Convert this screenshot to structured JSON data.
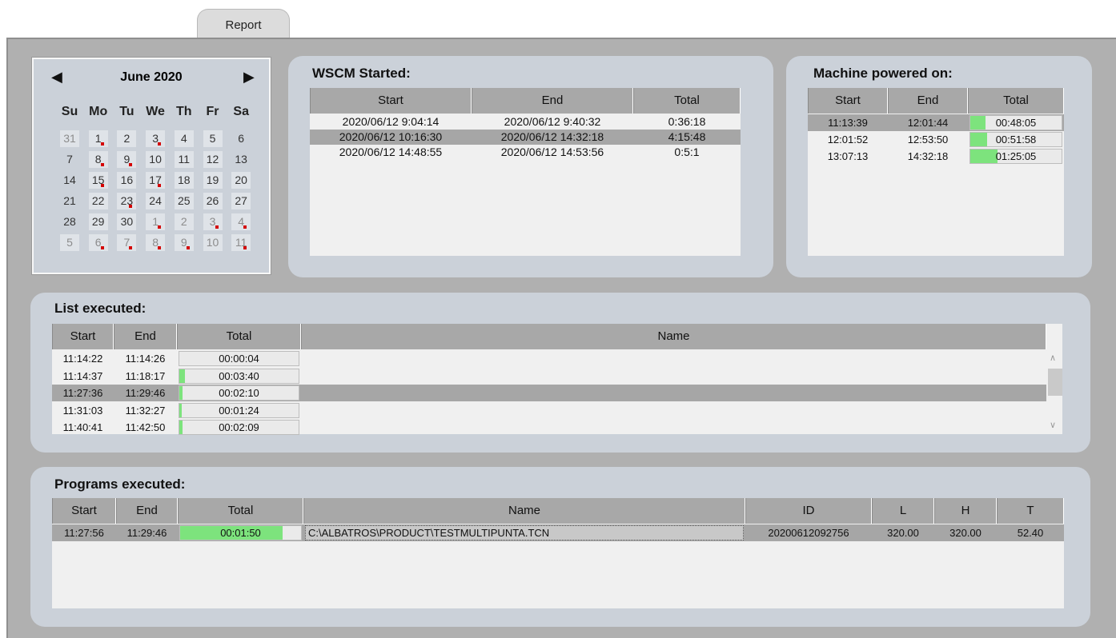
{
  "tab": {
    "label": "Report"
  },
  "calendar": {
    "title": "June 2020",
    "days_of_week": [
      "Su",
      "Mo",
      "Tu",
      "We",
      "Th",
      "Fr",
      "Sa"
    ],
    "weeks": [
      [
        {
          "d": "31",
          "o": true,
          "b": true,
          "m": false
        },
        {
          "d": "1",
          "o": false,
          "b": true,
          "m": true
        },
        {
          "d": "2",
          "o": false,
          "b": true,
          "m": false
        },
        {
          "d": "3",
          "o": false,
          "b": true,
          "m": true
        },
        {
          "d": "4",
          "o": false,
          "b": true,
          "m": false
        },
        {
          "d": "5",
          "o": false,
          "b": true,
          "m": false
        },
        {
          "d": "6",
          "o": false,
          "b": false,
          "m": false
        }
      ],
      [
        {
          "d": "7",
          "o": false,
          "b": false,
          "m": false
        },
        {
          "d": "8",
          "o": false,
          "b": true,
          "m": true
        },
        {
          "d": "9",
          "o": false,
          "b": true,
          "m": true
        },
        {
          "d": "10",
          "o": false,
          "b": true,
          "m": false
        },
        {
          "d": "11",
          "o": false,
          "b": true,
          "m": false
        },
        {
          "d": "12",
          "o": false,
          "b": true,
          "m": false
        },
        {
          "d": "13",
          "o": false,
          "b": false,
          "m": false
        }
      ],
      [
        {
          "d": "14",
          "o": false,
          "b": false,
          "m": false
        },
        {
          "d": "15",
          "o": false,
          "b": true,
          "m": true
        },
        {
          "d": "16",
          "o": false,
          "b": true,
          "m": false
        },
        {
          "d": "17",
          "o": false,
          "b": true,
          "m": true
        },
        {
          "d": "18",
          "o": false,
          "b": true,
          "m": false
        },
        {
          "d": "19",
          "o": false,
          "b": true,
          "m": false
        },
        {
          "d": "20",
          "o": false,
          "b": true,
          "m": false
        }
      ],
      [
        {
          "d": "21",
          "o": false,
          "b": false,
          "m": false
        },
        {
          "d": "22",
          "o": false,
          "b": true,
          "m": false
        },
        {
          "d": "23",
          "o": false,
          "b": true,
          "m": true
        },
        {
          "d": "24",
          "o": false,
          "b": true,
          "m": false
        },
        {
          "d": "25",
          "o": false,
          "b": true,
          "m": false
        },
        {
          "d": "26",
          "o": false,
          "b": true,
          "m": false
        },
        {
          "d": "27",
          "o": false,
          "b": true,
          "m": false
        }
      ],
      [
        {
          "d": "28",
          "o": false,
          "b": false,
          "m": false
        },
        {
          "d": "29",
          "o": false,
          "b": true,
          "m": false
        },
        {
          "d": "30",
          "o": false,
          "b": true,
          "m": false
        },
        {
          "d": "1",
          "o": true,
          "b": true,
          "m": true
        },
        {
          "d": "2",
          "o": true,
          "b": true,
          "m": false
        },
        {
          "d": "3",
          "o": true,
          "b": true,
          "m": true
        },
        {
          "d": "4",
          "o": true,
          "b": true,
          "m": true
        }
      ],
      [
        {
          "d": "5",
          "o": true,
          "b": true,
          "m": false
        },
        {
          "d": "6",
          "o": true,
          "b": true,
          "m": true
        },
        {
          "d": "7",
          "o": true,
          "b": true,
          "m": true
        },
        {
          "d": "8",
          "o": true,
          "b": true,
          "m": true
        },
        {
          "d": "9",
          "o": true,
          "b": true,
          "m": true
        },
        {
          "d": "10",
          "o": true,
          "b": true,
          "m": false
        },
        {
          "d": "11",
          "o": true,
          "b": true,
          "m": true
        }
      ]
    ]
  },
  "wscm": {
    "title": "WSCM Started:",
    "columns": [
      "Start",
      "End",
      "Total"
    ],
    "rows": [
      {
        "cells": [
          "2020/06/12 9:04:14",
          "2020/06/12 9:40:32",
          "0:36:18"
        ],
        "selected": false
      },
      {
        "cells": [
          "2020/06/12 10:16:30",
          "2020/06/12 14:32:18",
          "4:15:48"
        ],
        "selected": true
      },
      {
        "cells": [
          "2020/06/12 14:48:55",
          "2020/06/12 14:53:56",
          "0:5:1"
        ],
        "selected": false
      }
    ]
  },
  "machine": {
    "title": "Machine powered on:",
    "columns": [
      "Start",
      "End",
      "Total"
    ],
    "rows": [
      {
        "start": "11:13:39",
        "end": "12:01:44",
        "total": "00:48:05",
        "fill": 0.17,
        "selected": true
      },
      {
        "start": "12:01:52",
        "end": "12:53:50",
        "total": "00:51:58",
        "fill": 0.18,
        "selected": false
      },
      {
        "start": "13:07:13",
        "end": "14:32:18",
        "total": "01:25:05",
        "fill": 0.3,
        "selected": false
      }
    ]
  },
  "list": {
    "title": "List executed:",
    "columns": [
      "Start",
      "End",
      "Total",
      "Name"
    ],
    "rows": [
      {
        "start": "11:14:22",
        "end": "11:14:26",
        "total": "00:00:04",
        "fill": 0.0,
        "name": "",
        "selected": false
      },
      {
        "start": "11:14:37",
        "end": "11:18:17",
        "total": "00:03:40",
        "fill": 0.05,
        "name": "",
        "selected": false
      },
      {
        "start": "11:27:36",
        "end": "11:29:46",
        "total": "00:02:10",
        "fill": 0.03,
        "name": "",
        "selected": true
      },
      {
        "start": "11:31:03",
        "end": "11:32:27",
        "total": "00:01:24",
        "fill": 0.02,
        "name": "",
        "selected": false
      },
      {
        "start": "11:40:41",
        "end": "11:42:50",
        "total": "00:02:09",
        "fill": 0.03,
        "name": "",
        "selected": false
      }
    ]
  },
  "programs": {
    "title": "Programs executed:",
    "columns": [
      "Start",
      "End",
      "Total",
      "Name",
      "ID",
      "L",
      "H",
      "T"
    ],
    "rows": [
      {
        "start": "11:27:56",
        "end": "11:29:46",
        "total": "00:01:50",
        "fill": 0.85,
        "name": "C:\\ALBATROS\\PRODUCT\\TESTMULTIPUNTA.TCN",
        "id": "20200612092756",
        "l": "320.00",
        "h": "320.00",
        "t": "52.40",
        "selected": true
      }
    ]
  },
  "colors": {
    "accent_fill": "#7de37d",
    "marker": "#d40000",
    "panel": "#cbd1d9"
  }
}
